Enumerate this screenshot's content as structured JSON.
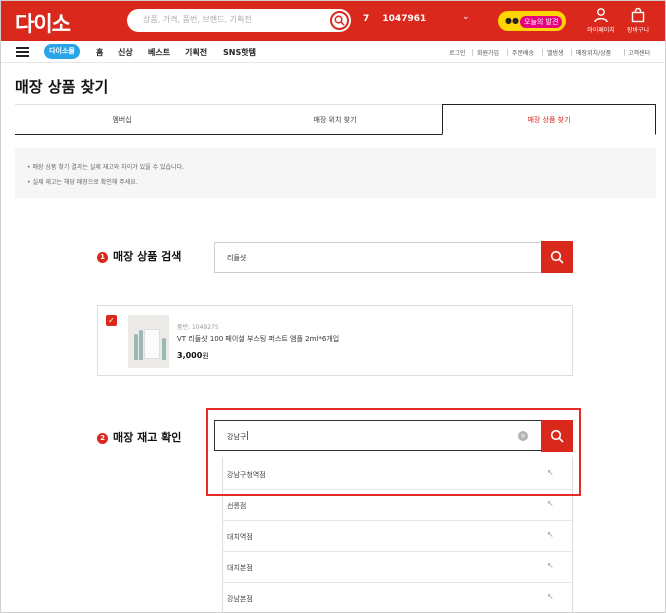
{
  "header": {
    "logo": "다이소",
    "search_placeholder": "상품, 가격, 품번, 브랜드, 기획전",
    "rank_index": "7",
    "rank_value": "1047961",
    "today_eyes": "●●",
    "today_label": "오늘의 발견",
    "mypage_label": "마이페이지",
    "cart_label": "장바구니"
  },
  "nav": {
    "mascot_label": "다이소몰",
    "items": [
      "홈",
      "신상",
      "베스트",
      "기획전",
      "SNS핫템"
    ],
    "utility": [
      "로그인",
      "회원가입",
      "주문배송",
      "앨범생",
      "매장위치/상품",
      "고객센터"
    ]
  },
  "page": {
    "title": "매장 상품 찾기",
    "tabs": [
      "멤버십",
      "매장 위치 찾기",
      "매장 상품 찾기"
    ],
    "notices": [
      "• 매장 상품 찾기 결과는 실제 재고와 차이가 있을 수 있습니다.",
      "• 실제 재고는 해당 매장으로 확인해 주세요."
    ]
  },
  "step1": {
    "number": "1",
    "label": "매장 상품 검색",
    "value": "리들샷"
  },
  "product": {
    "code": "품번: 1049275",
    "name": "VT 리들샷 100 페이셜 부스팅 퍼스트 앰플 2ml*6개입",
    "price": "3,000",
    "currency": "원",
    "checked": "✓"
  },
  "step2": {
    "number": "2",
    "label": "매장 재고 확인",
    "value": "강남구",
    "clear": "×"
  },
  "stores": [
    {
      "name": "강남구청역점",
      "arrow": "↖"
    },
    {
      "name": "선릉점",
      "arrow": "↖"
    },
    {
      "name": "대치역점",
      "arrow": "↖"
    },
    {
      "name": "대치본점",
      "arrow": "↖"
    },
    {
      "name": "강남본점",
      "arrow": "↖"
    }
  ],
  "colors": {
    "brand": "#da291c",
    "highlight": "#e22b26",
    "accent_yellow": "#ffd400"
  }
}
